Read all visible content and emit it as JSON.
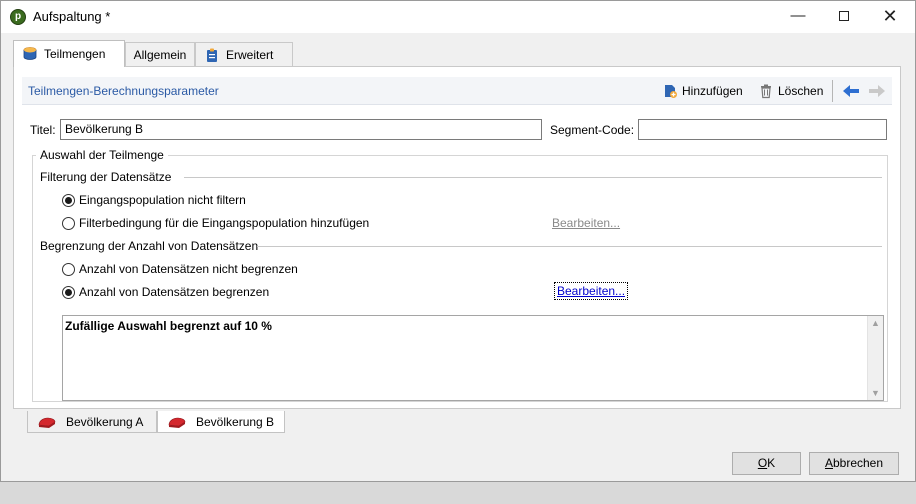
{
  "window": {
    "title": "Aufspaltung *",
    "app_icon": "app-logo-icon",
    "minimize": "—",
    "close": "✕"
  },
  "tabs": [
    {
      "label": "Teilmengen",
      "icon": "database-icon"
    },
    {
      "label": "Allgemein"
    },
    {
      "label": "Erweitert",
      "icon": "clipboard-icon"
    }
  ],
  "section": {
    "title": "Teilmengen-Berechnungsparameter",
    "add_label": "Hinzufügen",
    "delete_label": "Löschen"
  },
  "form": {
    "title_label": "Titel:",
    "title_value": "Bevölkerung B",
    "segment_label": "Segment-Code:",
    "segment_value": ""
  },
  "selection": {
    "legend": "Auswahl der Teilmenge",
    "filtering": {
      "legend": "Filterung der Datensätze",
      "option_no_filter": "Eingangspopulation nicht filtern",
      "option_add_filter": "Filterbedingung für die Eingangspopulation hinzufügen",
      "selected": "no_filter",
      "edit_label": "Bearbeiten..."
    },
    "limit": {
      "legend": "Begrenzung der Anzahl von Datensätzen",
      "option_no_limit": "Anzahl von Datensätzen nicht begrenzen",
      "option_limit": "Anzahl von Datensätzen begrenzen",
      "selected": "limit",
      "edit_label": "Bearbeiten..."
    },
    "summary": "Zufällige Auswahl begrenzt auf 10 %"
  },
  "subsets": [
    {
      "label": "Bevölkerung A",
      "active": false
    },
    {
      "label": "Bevölkerung B",
      "active": true
    }
  ],
  "buttons": {
    "ok_accel": "O",
    "ok_rest": "K",
    "cancel_accel": "A",
    "cancel_rest": "bbrechen"
  },
  "colors": {
    "link": "#2b5aa5",
    "arrow_back": "#2e6fd1",
    "pie": "#d4282e"
  }
}
